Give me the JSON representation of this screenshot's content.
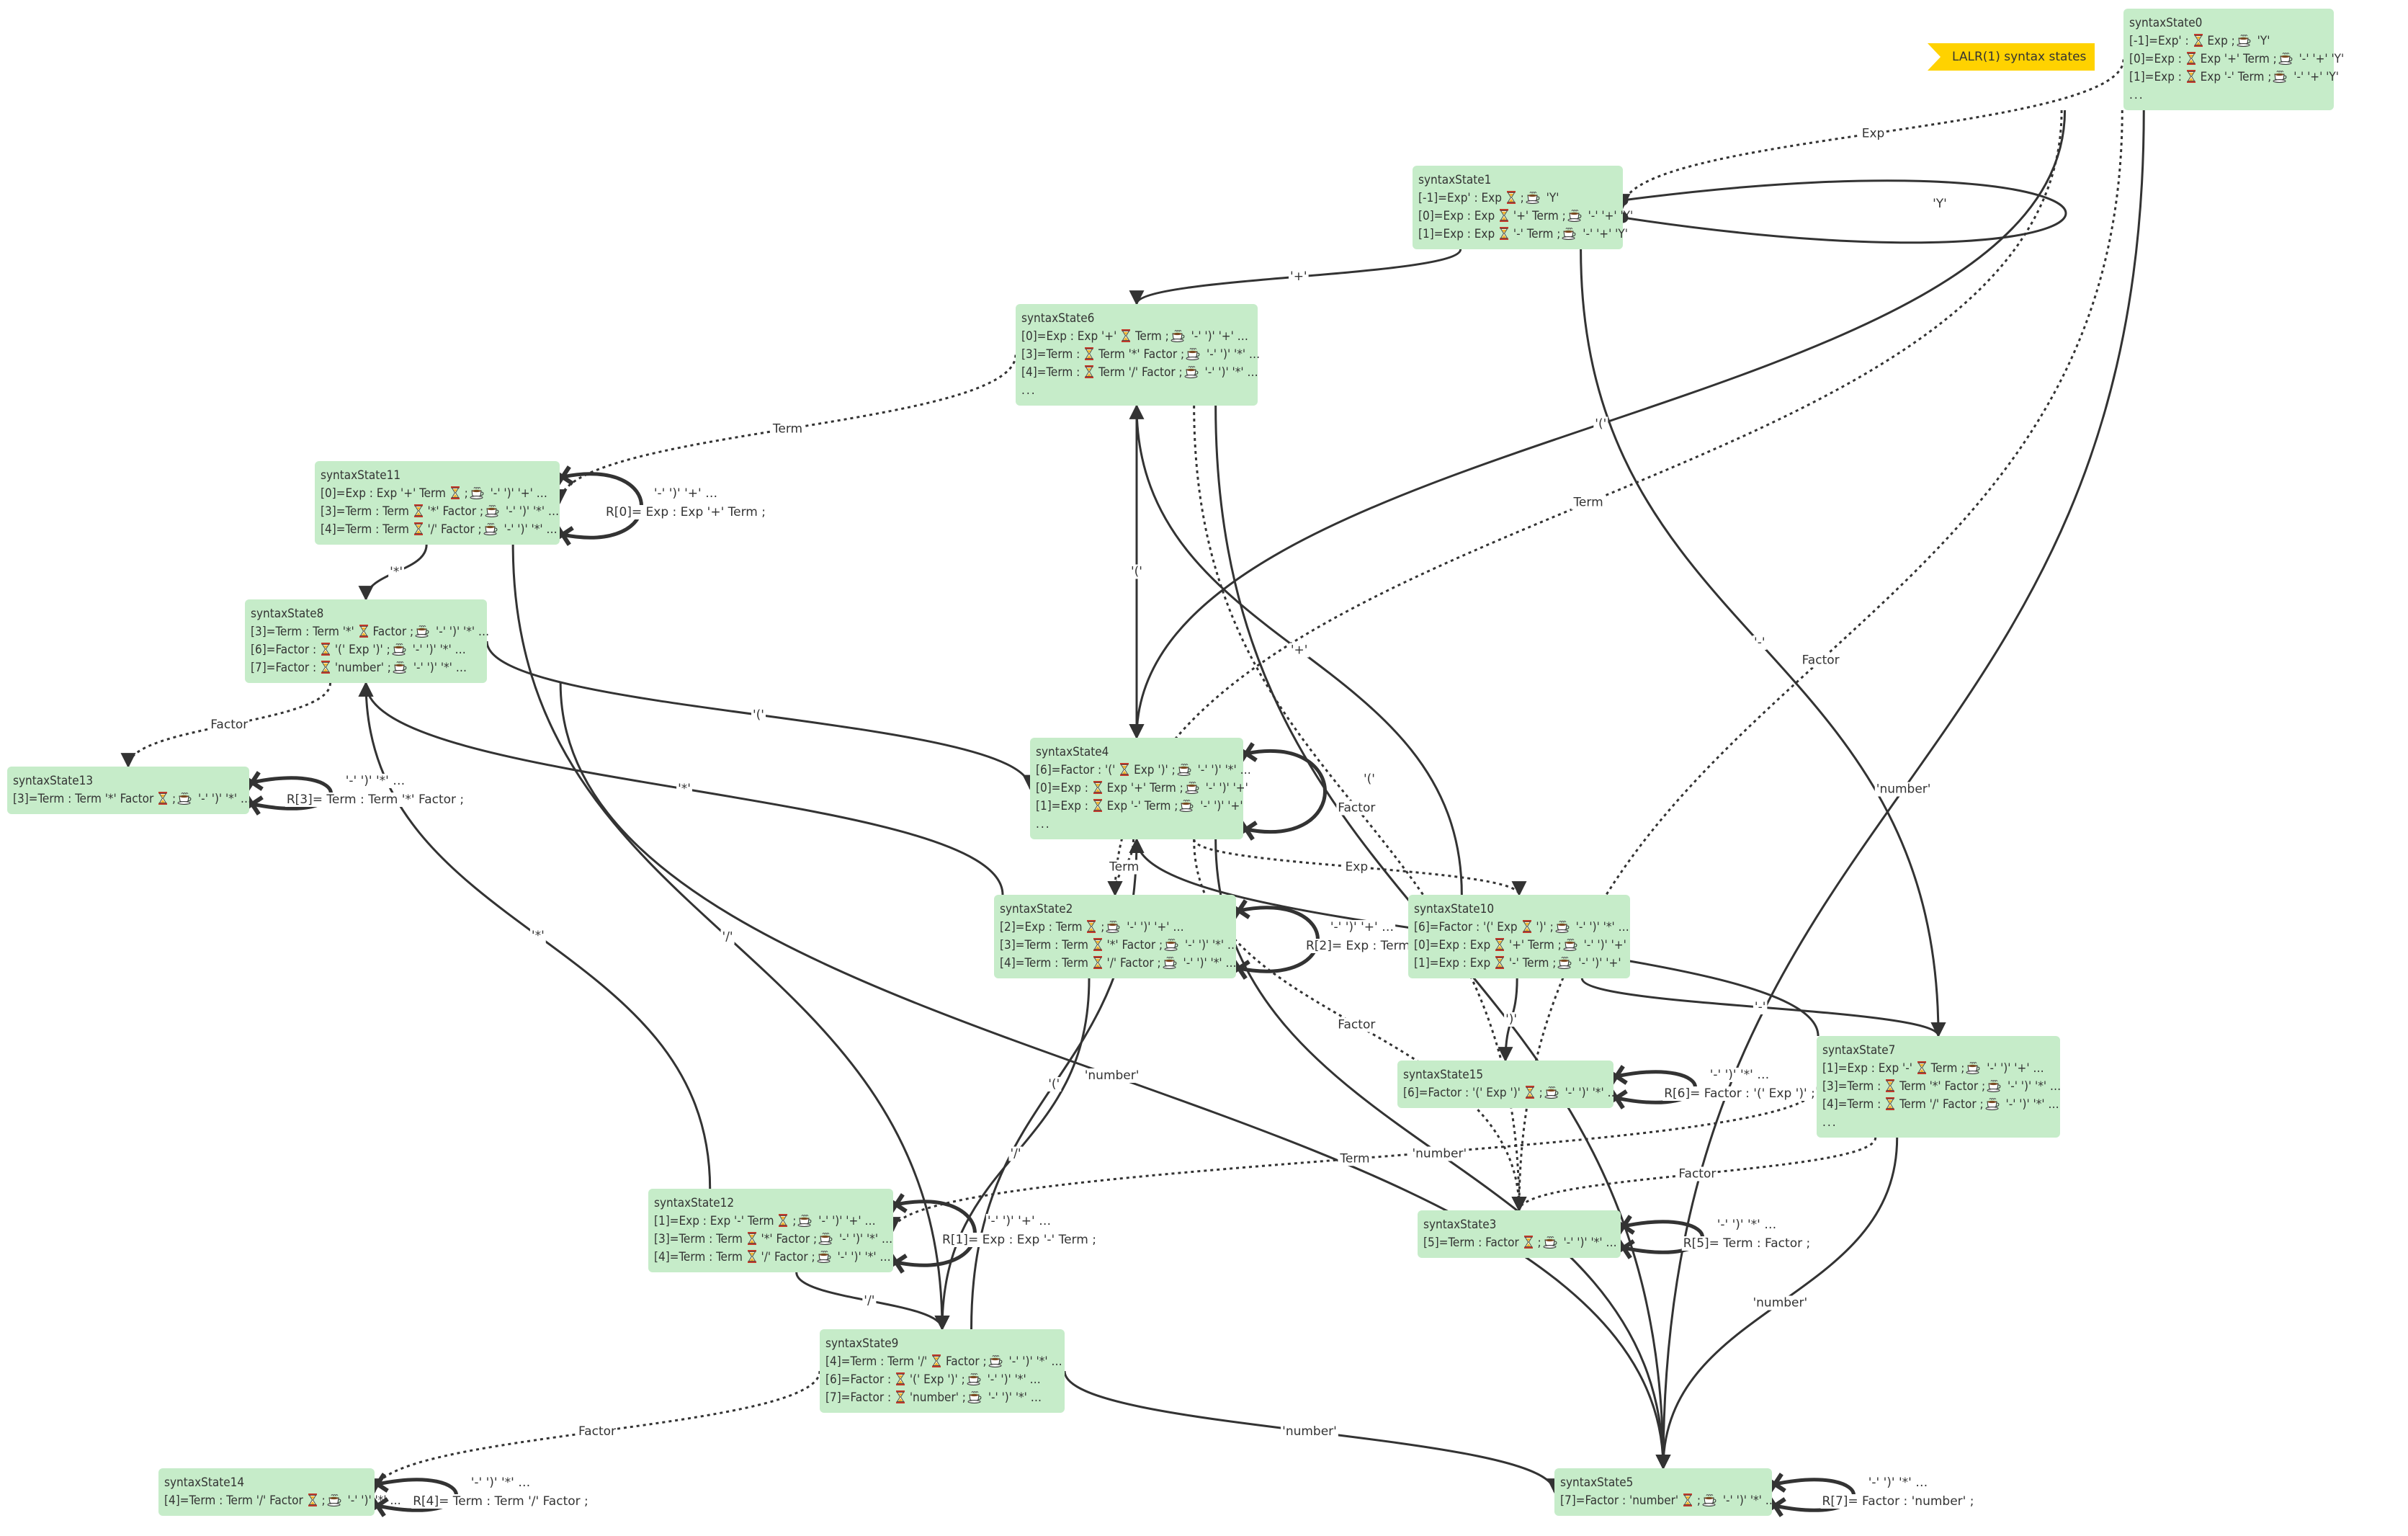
{
  "banner": {
    "text": "LALR(1) syntax states",
    "color": "#ffd200"
  },
  "colors": {
    "node_fill": "#c6ecc9",
    "edge": "#333333",
    "text": "#333333"
  },
  "icons": {
    "marker": "hourglass-icon",
    "lookahead": "coffee-cup-icon"
  },
  "nodes": [
    {
      "id": "syntaxState0",
      "title": "syntaxState0",
      "more": true,
      "items": [
        {
          "pre": "[-1]=Exp' : ",
          "post": " Exp ;",
          "look": " 'Y'"
        },
        {
          "pre": "[0]=Exp : ",
          "post": " Exp '+' Term ;",
          "look": " '-' '+' 'Y'"
        },
        {
          "pre": "[1]=Exp : ",
          "post": " Exp '-' Term ;",
          "look": " '-' '+' 'Y'"
        }
      ]
    },
    {
      "id": "syntaxState1",
      "title": "syntaxState1",
      "more": false,
      "items": [
        {
          "pre": "[-1]=Exp' : Exp ",
          "post": " ;",
          "look": " 'Y'"
        },
        {
          "pre": "[0]=Exp : Exp ",
          "post": " '+' Term ;",
          "look": " '-' '+' 'Y'"
        },
        {
          "pre": "[1]=Exp : Exp ",
          "post": " '-' Term ;",
          "look": " '-' '+' 'Y'"
        }
      ]
    },
    {
      "id": "syntaxState6",
      "title": "syntaxState6",
      "more": true,
      "items": [
        {
          "pre": "[0]=Exp : Exp '+' ",
          "post": " Term ;",
          "look": " '-' ')' '+' …"
        },
        {
          "pre": "[3]=Term : ",
          "post": " Term '*' Factor ;",
          "look": " '-' ')' '*' …"
        },
        {
          "pre": "[4]=Term : ",
          "post": " Term '/' Factor ;",
          "look": " '-' ')' '*' …"
        }
      ]
    },
    {
      "id": "syntaxState11",
      "title": "syntaxState11",
      "more": false,
      "items": [
        {
          "pre": "[0]=Exp : Exp '+' Term ",
          "post": " ;",
          "look": " '-' ')' '+' …"
        },
        {
          "pre": "[3]=Term : Term ",
          "post": " '*' Factor ;",
          "look": " '-' ')' '*' …"
        },
        {
          "pre": "[4]=Term : Term ",
          "post": " '/' Factor ;",
          "look": " '-' ')' '*' …"
        }
      ]
    },
    {
      "id": "syntaxState8",
      "title": "syntaxState8",
      "more": false,
      "items": [
        {
          "pre": "[3]=Term : Term '*' ",
          "post": " Factor ;",
          "look": " '-' ')' '*' …"
        },
        {
          "pre": "[6]=Factor : ",
          "post": " '(' Exp ')' ;",
          "look": " '-' ')' '*' …"
        },
        {
          "pre": "[7]=Factor : ",
          "post": " 'number' ;",
          "look": " '-' ')' '*' …"
        }
      ]
    },
    {
      "id": "syntaxState13",
      "title": "syntaxState13",
      "more": false,
      "items": [
        {
          "pre": "[3]=Term : Term '*' Factor ",
          "post": " ;",
          "look": " '-' ')' '*' …"
        }
      ]
    },
    {
      "id": "syntaxState4",
      "title": "syntaxState4",
      "more": true,
      "items": [
        {
          "pre": "[6]=Factor : '(' ",
          "post": " Exp ')' ;",
          "look": " '-' ')' '*' …"
        },
        {
          "pre": "[0]=Exp : ",
          "post": " Exp '+' Term ;",
          "look": " '-' ')' '+'"
        },
        {
          "pre": "[1]=Exp : ",
          "post": " Exp '-' Term ;",
          "look": " '-' ')' '+'"
        }
      ]
    },
    {
      "id": "syntaxState2",
      "title": "syntaxState2",
      "more": false,
      "items": [
        {
          "pre": "[2]=Exp : Term ",
          "post": " ;",
          "look": " '-' ')' '+' …"
        },
        {
          "pre": "[3]=Term : Term ",
          "post": " '*' Factor ;",
          "look": " '-' ')' '*' …"
        },
        {
          "pre": "[4]=Term : Term ",
          "post": " '/' Factor ;",
          "look": " '-' ')' '*' …"
        }
      ]
    },
    {
      "id": "syntaxState10",
      "title": "syntaxState10",
      "more": false,
      "items": [
        {
          "pre": "[6]=Factor : '(' Exp ",
          "post": " ')' ;",
          "look": " '-' ')' '*' …"
        },
        {
          "pre": "[0]=Exp : Exp ",
          "post": " '+' Term ;",
          "look": " '-' ')' '+'"
        },
        {
          "pre": "[1]=Exp : Exp ",
          "post": " '-' Term ;",
          "look": " '-' ')' '+'"
        }
      ]
    },
    {
      "id": "syntaxState15",
      "title": "syntaxState15",
      "more": false,
      "items": [
        {
          "pre": "[6]=Factor : '(' Exp ')' ",
          "post": " ;",
          "look": " '-' ')' '*' …"
        }
      ]
    },
    {
      "id": "syntaxState7",
      "title": "syntaxState7",
      "more": true,
      "items": [
        {
          "pre": "[1]=Exp : Exp '-' ",
          "post": " Term ;",
          "look": " '-' ')' '+' …"
        },
        {
          "pre": "[3]=Term : ",
          "post": " Term '*' Factor ;",
          "look": " '-' ')' '*' …"
        },
        {
          "pre": "[4]=Term : ",
          "post": " Term '/' Factor ;",
          "look": " '-' ')' '*' …"
        }
      ]
    },
    {
      "id": "syntaxState12",
      "title": "syntaxState12",
      "more": false,
      "items": [
        {
          "pre": "[1]=Exp : Exp '-' Term ",
          "post": " ;",
          "look": " '-' ')' '+' …"
        },
        {
          "pre": "[3]=Term : Term ",
          "post": " '*' Factor ;",
          "look": " '-' ')' '*' …"
        },
        {
          "pre": "[4]=Term : Term ",
          "post": " '/' Factor ;",
          "look": " '-' ')' '*' …"
        }
      ]
    },
    {
      "id": "syntaxState3",
      "title": "syntaxState3",
      "more": false,
      "items": [
        {
          "pre": "[5]=Term : Factor ",
          "post": " ;",
          "look": " '-' ')' '*' …"
        }
      ]
    },
    {
      "id": "syntaxState9",
      "title": "syntaxState9",
      "more": false,
      "items": [
        {
          "pre": "[4]=Term : Term '/' ",
          "post": " Factor ;",
          "look": " '-' ')' '*' …"
        },
        {
          "pre": "[6]=Factor : ",
          "post": " '(' Exp ')' ;",
          "look": " '-' ')' '*' …"
        },
        {
          "pre": "[7]=Factor : ",
          "post": " 'number' ;",
          "look": " '-' ')' '*' …"
        }
      ]
    },
    {
      "id": "syntaxState14",
      "title": "syntaxState14",
      "more": false,
      "items": [
        {
          "pre": "[4]=Term : Term '/' Factor ",
          "post": " ;",
          "look": " '-' ')' '*' …"
        }
      ]
    },
    {
      "id": "syntaxState5",
      "title": "syntaxState5",
      "more": false,
      "items": [
        {
          "pre": "[7]=Factor : 'number' ",
          "post": " ;",
          "look": " '-' ')' '*' …"
        }
      ]
    }
  ],
  "edges": [
    {
      "from": "syntaxState0",
      "to": "syntaxState1",
      "label": "Exp",
      "style": "dotted"
    },
    {
      "from": "syntaxState0",
      "to": "syntaxState2",
      "label": "Term",
      "style": "dotted"
    },
    {
      "from": "syntaxState0",
      "to": "syntaxState3",
      "label": "Factor",
      "style": "dotted"
    },
    {
      "from": "syntaxState0",
      "to": "syntaxState4",
      "label": "'('",
      "style": "solid"
    },
    {
      "from": "syntaxState0",
      "to": "syntaxState5",
      "label": "'number'",
      "style": "solid"
    },
    {
      "from": "syntaxState1",
      "to": "syntaxState1",
      "label": "'Y'",
      "style": "accept"
    },
    {
      "from": "syntaxState1",
      "to": "syntaxState6",
      "label": "'+'",
      "style": "solid"
    },
    {
      "from": "syntaxState1",
      "to": "syntaxState7",
      "label": "'-'",
      "style": "solid"
    },
    {
      "from": "syntaxState6",
      "to": "syntaxState11",
      "label": "Term",
      "style": "dotted"
    },
    {
      "from": "syntaxState6",
      "to": "syntaxState3",
      "label": "Factor",
      "style": "dotted"
    },
    {
      "from": "syntaxState6",
      "to": "syntaxState4",
      "label": "'('",
      "style": "solid"
    },
    {
      "from": "syntaxState6",
      "to": "syntaxState5",
      "label": "'number'",
      "style": "solid"
    },
    {
      "from": "syntaxState11",
      "to": "syntaxState11",
      "label": "'-' ')' '+' …",
      "reduce": "R[0]= Exp : Exp '+' Term ;",
      "style": "reduce"
    },
    {
      "from": "syntaxState11",
      "to": "syntaxState8",
      "label": "'*'",
      "style": "solid"
    },
    {
      "from": "syntaxState11",
      "to": "syntaxState9",
      "label": "'/'",
      "style": "solid"
    },
    {
      "from": "syntaxState8",
      "to": "syntaxState13",
      "label": "Factor",
      "style": "dotted"
    },
    {
      "from": "syntaxState8",
      "to": "syntaxState4",
      "label": "'('",
      "style": "solid"
    },
    {
      "from": "syntaxState8",
      "to": "syntaxState5",
      "label": "'number'",
      "style": "solid"
    },
    {
      "from": "syntaxState13",
      "to": "syntaxState13",
      "label": "'-' ')' '*' …",
      "reduce": "R[3]= Term : Term '*' Factor ;",
      "style": "reduce"
    },
    {
      "from": "syntaxState4",
      "to": "syntaxState10",
      "label": "Exp",
      "style": "dotted"
    },
    {
      "from": "syntaxState4",
      "to": "syntaxState2",
      "label": "Term",
      "style": "dotted"
    },
    {
      "from": "syntaxState4",
      "to": "syntaxState3",
      "label": "Factor",
      "style": "dotted"
    },
    {
      "from": "syntaxState4",
      "to": "syntaxState4",
      "label": "'('",
      "style": "solid"
    },
    {
      "from": "syntaxState4",
      "to": "syntaxState5",
      "label": "'number'",
      "style": "solid"
    },
    {
      "from": "syntaxState2",
      "to": "syntaxState2",
      "label": "'-' ')' '+' …",
      "reduce": "R[2]= Exp : Term ;",
      "style": "reduce"
    },
    {
      "from": "syntaxState2",
      "to": "syntaxState8",
      "label": "'*'",
      "style": "solid"
    },
    {
      "from": "syntaxState2",
      "to": "syntaxState9",
      "label": "'/'",
      "style": "solid"
    },
    {
      "from": "syntaxState10",
      "to": "syntaxState15",
      "label": "')'",
      "style": "solid"
    },
    {
      "from": "syntaxState10",
      "to": "syntaxState6",
      "label": "'+'",
      "style": "solid"
    },
    {
      "from": "syntaxState10",
      "to": "syntaxState7",
      "label": "'-'",
      "style": "solid"
    },
    {
      "from": "syntaxState15",
      "to": "syntaxState15",
      "label": "'-' ')' '*' …",
      "reduce": "R[6]= Factor : '(' Exp ')' ;",
      "style": "reduce"
    },
    {
      "from": "syntaxState7",
      "to": "syntaxState12",
      "label": "Term",
      "style": "dotted"
    },
    {
      "from": "syntaxState7",
      "to": "syntaxState3",
      "label": "Factor",
      "style": "dotted"
    },
    {
      "from": "syntaxState7",
      "to": "syntaxState4",
      "label": "'('",
      "style": "solid"
    },
    {
      "from": "syntaxState7",
      "to": "syntaxState5",
      "label": "'number'",
      "style": "solid"
    },
    {
      "from": "syntaxState12",
      "to": "syntaxState12",
      "label": "'-' ')' '+' …",
      "reduce": "R[1]= Exp : Exp '-' Term ;",
      "style": "reduce"
    },
    {
      "from": "syntaxState12",
      "to": "syntaxState8",
      "label": "'*'",
      "style": "solid"
    },
    {
      "from": "syntaxState12",
      "to": "syntaxState9",
      "label": "'/'",
      "style": "solid"
    },
    {
      "from": "syntaxState3",
      "to": "syntaxState3",
      "label": "'-' ')' '*' …",
      "reduce": "R[5]= Term : Factor ;",
      "style": "reduce"
    },
    {
      "from": "syntaxState9",
      "to": "syntaxState14",
      "label": "Factor",
      "style": "dotted"
    },
    {
      "from": "syntaxState9",
      "to": "syntaxState4",
      "label": "'('",
      "style": "solid"
    },
    {
      "from": "syntaxState9",
      "to": "syntaxState5",
      "label": "'number'",
      "style": "solid"
    },
    {
      "from": "syntaxState14",
      "to": "syntaxState14",
      "label": "'-' ')' '*' …",
      "reduce": "R[4]= Term : Term '/' Factor ;",
      "style": "reduce"
    },
    {
      "from": "syntaxState5",
      "to": "syntaxState5",
      "label": "'-' ')' '*' …",
      "reduce": "R[7]= Factor : 'number' ;",
      "style": "reduce"
    }
  ]
}
